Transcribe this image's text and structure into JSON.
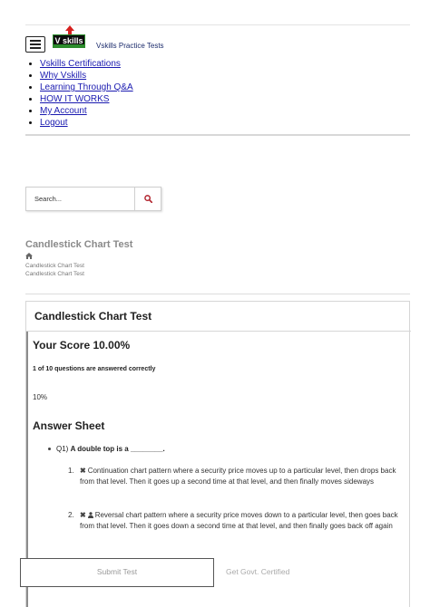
{
  "header": {
    "logo_text": "V skills",
    "brand": "Vskills Practice Tests"
  },
  "menu": {
    "items": [
      {
        "label": "Vskills Certifications"
      },
      {
        "label": "Why Vskills"
      },
      {
        "label": "Learning Through Q&A"
      },
      {
        "label": "HOW IT WORKS"
      },
      {
        "label": "My Account"
      },
      {
        "label": "Logout"
      }
    ]
  },
  "search": {
    "placeholder": "Search..."
  },
  "page": {
    "heading": "Candlestick Chart Test",
    "breadcrumb": [
      "Candlestick Chart Test",
      "Candlestick Chart Test"
    ]
  },
  "result": {
    "card_title": "Candlestick Chart Test",
    "score_title": "Your Score 10.00%",
    "summary": "1 of 10 questions are answered correctly",
    "percent": "10%",
    "answer_sheet_title": "Answer Sheet",
    "question": {
      "number": "Q1)",
      "text": "A double top is a ________.",
      "options": [
        {
          "num": "1.",
          "text": "Continuation chart pattern where a security price moves up to a particular level, then drops back from that level. Then it goes up a second time at that level, and then finally moves sideways"
        },
        {
          "num": "2.",
          "text": "Reversal chart pattern where a security price moves down to a particular level, then goes back from that level. Then it goes down a second time at that level, and then finally goes back off again"
        }
      ]
    }
  },
  "footer": {
    "submit_label": "Submit Test",
    "certified_label": "Get Govt. Certified"
  },
  "colors": {
    "link": "#1a1ab0",
    "brand_text": "#1a2a6b",
    "logo_red": "#d6201e",
    "logo_green": "#2c8c2c",
    "search_icon": "#b0202a"
  }
}
